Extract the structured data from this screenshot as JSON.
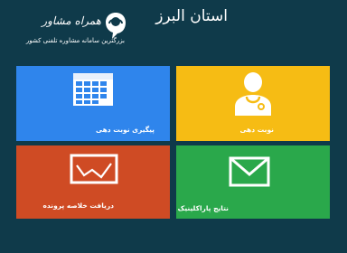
{
  "header": {
    "province_title": "استان البرز",
    "logo": {
      "name": "همراه مشاور",
      "tagline": "بزرگترین سامانه مشاوره تلفنی کشور"
    }
  },
  "tiles": [
    {
      "label": "پیگیری نوبت دهی",
      "icon": "calendar-icon",
      "color": "#2f85ec"
    },
    {
      "label": "نوبت دهی",
      "icon": "doctor-icon",
      "color": "#f6bc14"
    },
    {
      "label": "دریافت خلاصه پرونده",
      "icon": "chart-report-icon",
      "color": "#cf4b24"
    },
    {
      "label": "نتایج پاراکلینیک",
      "icon": "envelope-icon",
      "color": "#2aa84b"
    }
  ],
  "colors": {
    "background": "#0f3a4a",
    "text": "#ffffff"
  }
}
